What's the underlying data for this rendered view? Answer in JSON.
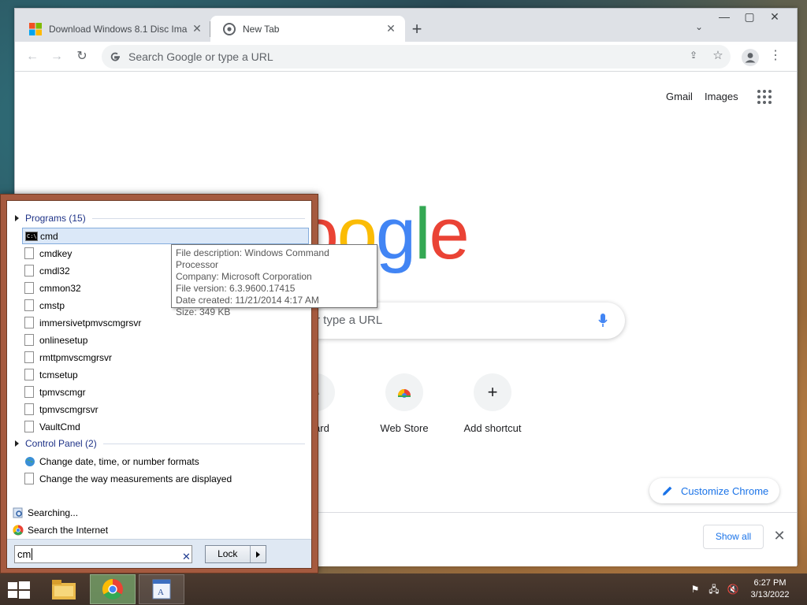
{
  "browser": {
    "tabs": [
      {
        "title": "Download Windows 8.1 Disc Ima",
        "favicon": "microsoft-logo-icon",
        "active": false
      },
      {
        "title": "New Tab",
        "favicon": "chrome-icon",
        "active": true
      }
    ],
    "omnibox": {
      "placeholder": "Search Google or type a URL"
    },
    "window_controls": [
      "minimize",
      "maximize",
      "close"
    ]
  },
  "ntp": {
    "header_links": {
      "gmail": "Gmail",
      "images": "Images"
    },
    "logo": "Google",
    "search_visible_text": "r type a URL",
    "shortcuts": [
      {
        "label": "nYard",
        "icon": "crumpled-paper-icon"
      },
      {
        "label": "Web Store",
        "icon": "chrome-web-store-icon"
      },
      {
        "label": "Add shortcut",
        "icon": "plus-icon"
      }
    ],
    "customize_label": "Customize Chrome",
    "download_bar": {
      "show_all_label": "Show all"
    }
  },
  "start_menu": {
    "programs_header": "Programs (15)",
    "programs": [
      "cmd",
      "cmdkey",
      "cmdl32",
      "cmmon32",
      "cmstp",
      "immersivetpmvscmgrsvr",
      "onlinesetup",
      "rmttpmvscmgrsvr",
      "tcmsetup",
      "tpmvscmgr",
      "tpmvscmgrsvr",
      "VaultCmd"
    ],
    "selected_program": "cmd",
    "control_panel_header": "Control Panel (2)",
    "control_panel_items": [
      "Change date, time, or number formats",
      "Change the way measurements are displayed"
    ],
    "searching_label": "Searching...",
    "search_internet_label": "Search the Internet",
    "search_value": "cm",
    "lock_label": "Lock",
    "tooltip": {
      "description": "File description: Windows Command Processor",
      "company": "Company: Microsoft Corporation",
      "version": "File version: 6.3.9600.17415",
      "created": "Date created: 11/21/2014 4:17 AM",
      "size": "Size: 349 KB"
    }
  },
  "taskbar": {
    "apps": [
      "file-explorer-icon",
      "chrome-icon",
      "wordpad-icon"
    ],
    "clock_time": "6:27 PM",
    "clock_date": "3/13/2022"
  },
  "colors": {
    "accent_blue": "#1a73e8",
    "start_menu_frame": "#a55a3f",
    "google_blue": "#4285f4",
    "google_red": "#ea4335",
    "google_yellow": "#fbbc05",
    "google_green": "#34a853"
  }
}
